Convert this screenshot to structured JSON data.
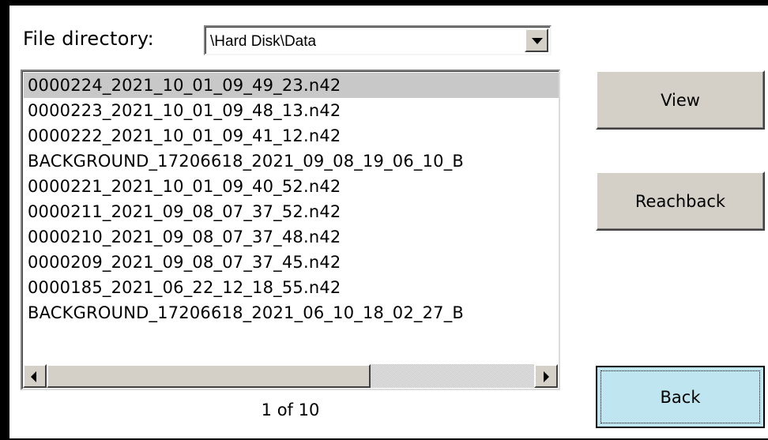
{
  "directory": {
    "label": "File directory:",
    "value": "\\Hard Disk\\Data"
  },
  "files": [
    "0000224_2021_10_01_09_49_23.n42",
    "0000223_2021_10_01_09_48_13.n42",
    "0000222_2021_10_01_09_41_12.n42",
    "BACKGROUND_17206618_2021_09_08_19_06_10_B",
    "0000221_2021_10_01_09_40_52.n42",
    "0000211_2021_09_08_07_37_52.n42",
    "0000210_2021_09_08_07_37_48.n42",
    "0000209_2021_09_08_07_37_45.n42",
    "0000185_2021_06_22_12_18_55.n42",
    "BACKGROUND_17206618_2021_06_10_18_02_27_B"
  ],
  "selected_index": 0,
  "page_indicator": "1 of 10",
  "buttons": {
    "view": "View",
    "reachback": "Reachback",
    "back": "Back"
  },
  "colors": {
    "selection": "#c8c8c8",
    "focused_button": "#bfe6f0"
  }
}
